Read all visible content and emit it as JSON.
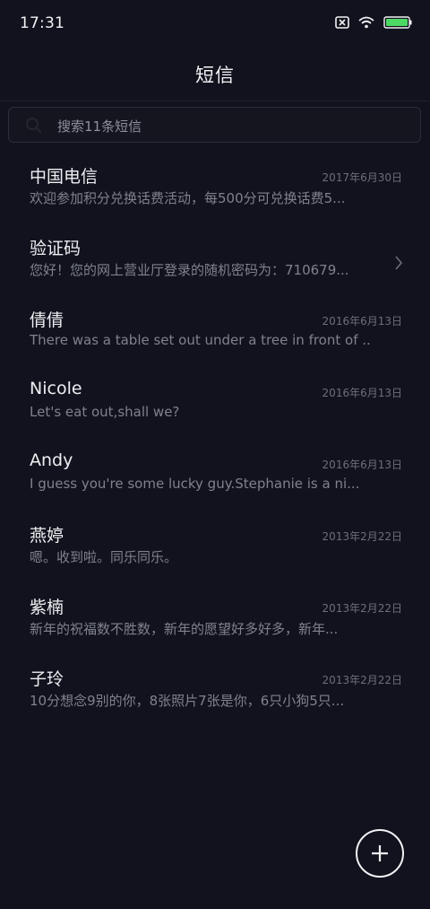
{
  "status_bar": {
    "time": "17:31",
    "icons": [
      "sim-off-icon",
      "wifi-icon",
      "battery-icon"
    ],
    "battery_color": "#4cd964"
  },
  "header": {
    "title": "短信"
  },
  "search": {
    "placeholder": "搜索11条短信"
  },
  "messages": [
    {
      "name": "中国电信",
      "date": "2017年6月30日",
      "preview": "欢迎参加积分兑换话费活动，每500分可兑换话费5..."
    },
    {
      "name": "验证码",
      "date": "",
      "preview": "您好！您的网上营业厅登录的随机密码为：710679..."
    },
    {
      "name": "倩倩",
      "date": "2016年6月13日",
      "preview": "There was a table set out under a tree in front of ..."
    },
    {
      "name": "Nicole",
      "date": "2016年6月13日",
      "preview": "Let's eat out,shall we?"
    },
    {
      "name": "Andy",
      "date": "2016年6月13日",
      "preview": "I guess you're some lucky guy.Stephanie is a ni..."
    },
    {
      "name": "燕婷",
      "date": "2013年2月22日",
      "preview": "嗯。收到啦。同乐同乐。"
    },
    {
      "name": "紫楠",
      "date": "2013年2月22日",
      "preview": "新年的祝福数不胜数，新年的愿望好多好多，新年..."
    },
    {
      "name": "子玲",
      "date": "2013年2月22日",
      "preview": "10分想念9别的你，8张照片7张是你，6只小狗5只..."
    }
  ],
  "colors": {
    "background": "#11121d",
    "primary_text": "#eeeef2",
    "secondary_text": "#7f818c",
    "date_text": "#6c6e7a"
  }
}
